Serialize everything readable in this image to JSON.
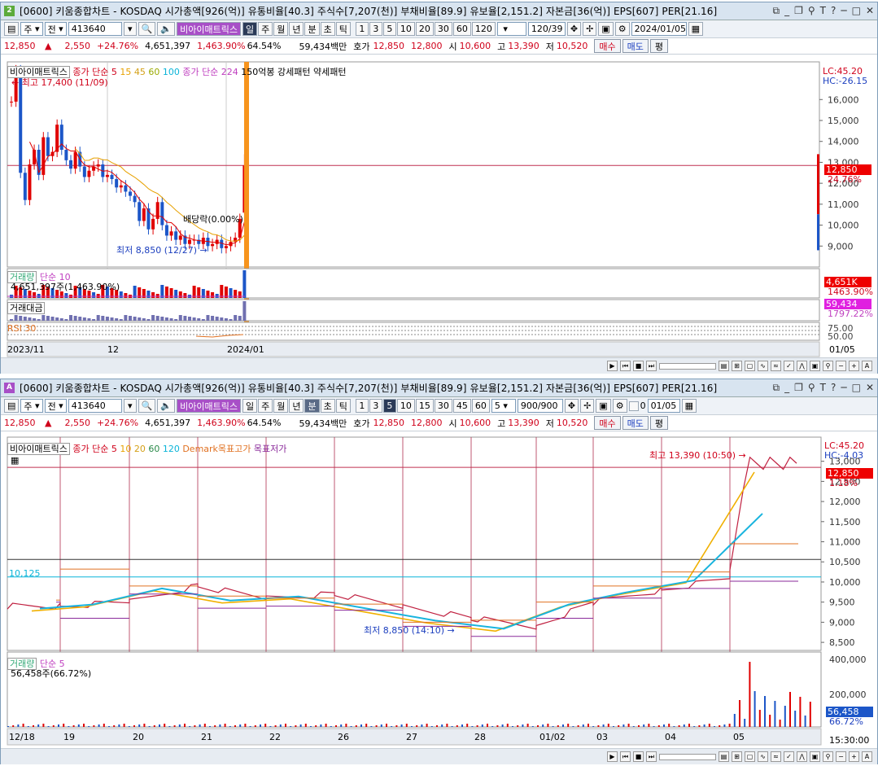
{
  "win1": {
    "num": "2",
    "num_color": "#5cab3b",
    "title": "[0600] 키움종합차트 - KOSDAQ 시가총액[926(억)] 유통비율[40.3] 주식수[7,207(천)] 부채비율[89.9] 유보율[2,151.2] 자본금[36(억)] EPS[607] PER[21.16]",
    "controls": [
      "▭",
      "⌐",
      "▭",
      "T",
      "T",
      "?",
      "_",
      "□",
      "✕"
    ],
    "toolbar": {
      "type": "주",
      "scope": "전",
      "code": "413640",
      "name": "비아이매트릭스",
      "periods": [
        "일",
        "주",
        "월",
        "년",
        "분",
        "초",
        "틱"
      ],
      "period_sel": "일",
      "nums": [
        "1",
        "3",
        "5",
        "10",
        "20",
        "30",
        "60",
        "120"
      ],
      "count": "120/39",
      "date": "2024/01/05"
    },
    "info": {
      "price": "12,850",
      "arrow": "▲",
      "change": "2,550",
      "pct": "+24.76%",
      "vol": "4,651,397",
      "volpct": "1,463.90%",
      "turn": "64.54%",
      "amount": "59,434백만",
      "hoga_l": "호가",
      "hoga1": "12,850",
      "hoga2": "12,800",
      "open_l": "시",
      "open": "10,600",
      "high_l": "고",
      "high": "13,390",
      "low_l": "저",
      "low": "10,520",
      "buy": "매수",
      "sell": "매도",
      "avg": "평"
    },
    "legend": {
      "name": "비아이매트릭스",
      "ma_l": "종가 단순",
      "ma": [
        "5",
        "15",
        "45",
        "60",
        "100"
      ],
      "ma2": "종가 단순 224",
      "pattern": "150억봉 강세패턴",
      "pattern2": "약세패턴"
    },
    "ann": {
      "high": "최고 17,400 (11/09)",
      "low": "최저 8,850 (12/27)",
      "div": "배당락(0.00%)"
    },
    "vol_legend": {
      "name": "거래량",
      "ma": "단순 10",
      "value": "4,651,397주(1,463.90%)"
    },
    "amt_legend": {
      "name": "거래대금"
    },
    "rsi_legend": {
      "name": "RSI 30"
    },
    "right": {
      "lc": "LC:45.20",
      "hc": "HC:-26.15",
      "price": "12,850",
      "pct": "24.76%",
      "vol": "4,651K",
      "volpct": "1463.90%",
      "amt": "59,434",
      "amtpct": "1797.22%",
      "rsi1": "75.00",
      "rsi2": "50.00"
    },
    "xlabels": [
      "2023/11",
      "12",
      "2024/01"
    ],
    "xright": "01/05"
  },
  "win2": {
    "num": "A",
    "num_color": "#a84fc7",
    "title": "[0600] 키움종합차트 - KOSDAQ 시가총액[926(억)] 유통비율[40.3] 주식수[7,207(천)] 부채비율[89.9] 유보율[2,151.2] 자본금[36(억)] EPS[607] PER[21.16]",
    "toolbar": {
      "type": "주",
      "scope": "전",
      "code": "413640",
      "name": "비아이매트릭스",
      "periods": [
        "일",
        "주",
        "월",
        "년",
        "분",
        "초",
        "틱"
      ],
      "period_sel": "분",
      "nums": [
        "1",
        "3",
        "5",
        "10",
        "15",
        "30",
        "45",
        "60"
      ],
      "num_sel": "5",
      "interval": "5",
      "count": "900/900",
      "date": "01/05",
      "chk": "0"
    },
    "legend": {
      "name": "비아이매트릭스",
      "ma_l": "종가 단순",
      "ma": [
        "5",
        "10",
        "20",
        "60",
        "120"
      ],
      "demark": "Demark목표고가",
      "demark2": "목표저가"
    },
    "ann": {
      "high": "최고 13,390 (10:50)",
      "low": "최저 8,850 (14:10)",
      "level": "10,125"
    },
    "vol_legend": {
      "name": "거래량",
      "ma": "단순 5",
      "value": "56,458주(66.72%)"
    },
    "right": {
      "lc": "LC:45.20",
      "hc": "HC:-4.03",
      "price": "12,850",
      "pct": "1.18%",
      "vol": "56,458",
      "volpct": "66.72%",
      "time": "15:30:00"
    },
    "xlabels": [
      "12/18",
      "19",
      "20",
      "21",
      "22",
      "26",
      "27",
      "28",
      "01/02",
      "03",
      "04",
      "05"
    ]
  },
  "chart_data": [
    {
      "type": "candlestick",
      "title": "비아이매트릭스 일봉",
      "ylim": [
        8000,
        17800
      ],
      "yticks": [
        9000,
        10000,
        11000,
        12000,
        13000,
        14000,
        15000,
        16000
      ],
      "ma_periods": [
        5,
        15,
        45,
        60,
        100,
        224
      ],
      "last": {
        "open": 10600,
        "high": 13390,
        "low": 10520,
        "close": 12850
      },
      "series": [
        {
          "name": "종가",
          "values": [
            15900,
            17400,
            12500,
            11200,
            12900,
            13600,
            12400,
            14200,
            13300,
            13500,
            14800,
            13600,
            13100,
            12700,
            13500,
            12800,
            12300,
            12600,
            12800,
            12900,
            12300,
            12400,
            12200,
            11800,
            11900,
            11600,
            11400,
            11100,
            10200,
            10800,
            9800,
            10300,
            11100,
            10000,
            9500,
            9700,
            9300,
            9500,
            9100,
            9300,
            9300,
            9100,
            9400,
            9000,
            9100,
            9300,
            8900,
            9000,
            9200,
            9400,
            10300,
            12850
          ]
        }
      ]
    },
    {
      "type": "line",
      "title": "비아이매트릭스 5분봉",
      "ylim": [
        8300,
        13600
      ],
      "yticks": [
        8500,
        9000,
        9500,
        10000,
        10500,
        11000,
        11500,
        12000,
        12500,
        13000
      ],
      "x": [
        "12/18",
        "19",
        "20",
        "21",
        "22",
        "26",
        "27",
        "28",
        "01/02",
        "03",
        "04",
        "05"
      ],
      "series": [
        {
          "name": "종가",
          "values": [
            9400,
            9500,
            9900,
            9600,
            9700,
            9400,
            9100,
            8900,
            9500,
            9800,
            10100,
            12850
          ]
        }
      ],
      "annotations": [
        {
          "label": "최고 13,390 (10:50)",
          "value": 13390
        },
        {
          "label": "최저 8,850 (14:10)",
          "value": 8850
        },
        {
          "label": "10,125",
          "value": 10125
        }
      ]
    }
  ]
}
